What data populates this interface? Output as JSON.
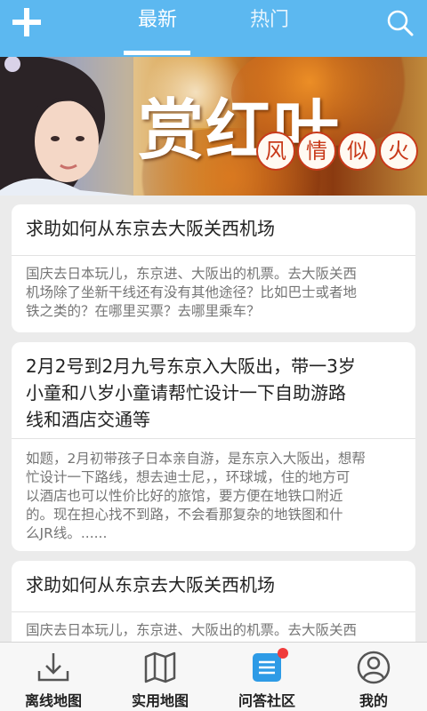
{
  "header": {
    "tabs": [
      {
        "label": "最新",
        "active": true
      },
      {
        "label": "热门",
        "active": false
      }
    ],
    "icons": {
      "left": "plus-icon",
      "right": "search-icon"
    },
    "accent_color": "#5cb8f0"
  },
  "banner": {
    "title": "赏红叶",
    "subtitle_chars": [
      "风",
      "情",
      "似",
      "火"
    ]
  },
  "posts": [
    {
      "title_lines": [
        "求助如何从东京去大阪关西机场"
      ],
      "body_lines": [
        "国庆去日本玩儿，东京进、大阪出的机票。去大阪关西",
        "机场除了坐新干线还有没有其他途径？比如巴士或者地",
        "铁之类的？在哪里买票？去哪里乘车？"
      ]
    },
    {
      "title_lines": [
        "2月2号到2月九号东京入大阪出，带一3岁",
        "小童和八岁小童请帮忙设计一下自助游路",
        "线和酒店交通等"
      ],
      "body_lines": [
        "如题，2月初带孩子日本亲自游，是东京入大阪出，想帮",
        "忙设计一下路线，想去迪士尼，，环球城，住的地方可",
        "以酒店也可以性价比好的旅馆，要方便在地铁口附近",
        "的。现在担心找不到路，不会看那复杂的地铁图和什",
        "么JR线。......"
      ]
    },
    {
      "title_lines": [
        "求助如何从东京去大阪关西机场"
      ],
      "body_lines": [
        "国庆去日本玩儿，东京进、大阪出的机票。去大阪关西"
      ]
    }
  ],
  "bottom_nav": [
    {
      "label": "离线地图",
      "icon": "download-icon"
    },
    {
      "label": "实用地图",
      "icon": "map-icon"
    },
    {
      "label": "问答社区",
      "icon": "qa-document-icon",
      "active": true,
      "badge": true
    },
    {
      "label": "我的",
      "icon": "user-icon"
    }
  ]
}
